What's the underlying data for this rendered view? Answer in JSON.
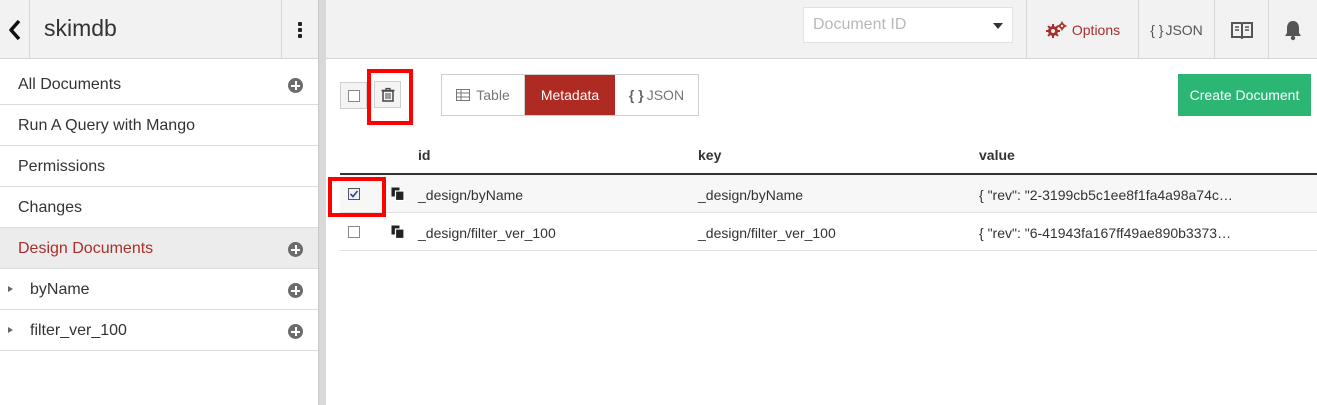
{
  "sidebar": {
    "db_name": "skimdb",
    "items": [
      {
        "label": "All Documents"
      },
      {
        "label": "Run A Query with Mango"
      },
      {
        "label": "Permissions"
      },
      {
        "label": "Changes"
      },
      {
        "label": "Design Documents"
      },
      {
        "label": "byName"
      },
      {
        "label": "filter_ver_100"
      }
    ]
  },
  "topbar": {
    "docid_placeholder": "Document ID",
    "options_label": "Options",
    "json_label": "JSON",
    "json_braces": "{ }"
  },
  "toolbar": {
    "views": [
      {
        "label": "Table",
        "active": false
      },
      {
        "label": "Metadata",
        "active": true
      },
      {
        "label": "JSON",
        "active": false
      }
    ],
    "json_braces": "{ }",
    "create_label": "Create Document"
  },
  "table": {
    "columns": [
      "id",
      "key",
      "value"
    ],
    "rows": [
      {
        "id": "_design/byName",
        "key": "_design/byName",
        "value": "{ \"rev\": \"2-3199cb5c1ee8f1fa4a98a74c…",
        "checked": true
      },
      {
        "id": "_design/filter_ver_100",
        "key": "_design/filter_ver_100",
        "value": "{ \"rev\": \"6-41943fa167ff49ae890b3373…",
        "checked": false
      }
    ]
  },
  "colors": {
    "accent": "#a8302b",
    "metadata_active": "#b02a24",
    "create_button": "#2bb673",
    "highlight": "#ff0000"
  },
  "icons": [
    "back-arrow-icon",
    "vertical-dots-icon",
    "gears-icon",
    "book-icon",
    "bell-icon",
    "trash-icon",
    "table-icon",
    "copy-icon",
    "plus-circle-icon",
    "caret-right-icon",
    "caret-down-icon"
  ]
}
